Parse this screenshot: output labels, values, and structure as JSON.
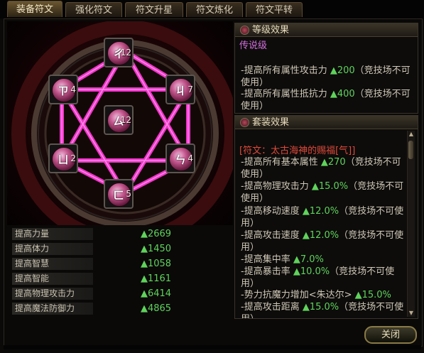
{
  "tabs": [
    {
      "label": "装备符文",
      "active": true
    },
    {
      "label": "强化符文",
      "active": false
    },
    {
      "label": "符文升星",
      "active": false
    },
    {
      "label": "符文炼化",
      "active": false
    },
    {
      "label": "符文平转",
      "active": false
    }
  ],
  "runes": [
    {
      "position": "top",
      "glyph": "ㄔ",
      "count": "12"
    },
    {
      "position": "upper-left",
      "glyph": "ㄗ",
      "count": "4"
    },
    {
      "position": "upper-right",
      "glyph": "ㄐ",
      "count": "7"
    },
    {
      "position": "center",
      "glyph": "ㄙ",
      "count": "12"
    },
    {
      "position": "lower-left",
      "glyph": "ㄩ",
      "count": "2"
    },
    {
      "position": "lower-right",
      "glyph": "ㄣ",
      "count": "4"
    },
    {
      "position": "bottom",
      "glyph": "ㄈ",
      "count": "5"
    }
  ],
  "stats": [
    {
      "label": "提高力量",
      "value": "▲2669"
    },
    {
      "label": "提高体力",
      "value": "▲1450"
    },
    {
      "label": "提高智慧",
      "value": "▲1058"
    },
    {
      "label": "提高智能",
      "value": "▲1161"
    },
    {
      "label": "提高物理攻击力",
      "value": "▲6414"
    },
    {
      "label": "提高魔法防御力",
      "value": "▲4865"
    }
  ],
  "level_effect": {
    "title": "等级效果",
    "tier": "传说级",
    "lines": [
      {
        "text": "-提高所有属性攻击力 ",
        "value": "▲200",
        "suffix": "（竞技场不可使用）"
      },
      {
        "text": "-提高所有属性抵抗力 ",
        "value": "▲400",
        "suffix": "（竞技场不可使用）"
      }
    ]
  },
  "set_effect": {
    "title": "套装效果",
    "set_name": "[符文：太古海神的赐福[气]]",
    "lines": [
      {
        "text": "-提高所有基本属性 ",
        "value": "▲270",
        "suffix": "（竞技场不可使用）"
      },
      {
        "text": "-提高物理攻击力 ",
        "value": "▲15.0%",
        "suffix": "（竞技场不可使用）"
      },
      {
        "text": "-提高移动速度 ",
        "value": "▲12.0%",
        "suffix": "（竞技场不可使用）"
      },
      {
        "text": "-提高攻击速度 ",
        "value": "▲12.0%",
        "suffix": "（竞技场不可使用）"
      },
      {
        "text": "-提高集中率 ",
        "value": "▲7.0%",
        "suffix": ""
      },
      {
        "text": "-提高暴击率 ",
        "value": "▲10.0%",
        "suffix": "（竞技场不可使用）"
      },
      {
        "text": "-势力抗魔力增加<朱达尔> ",
        "value": "▲15.0%",
        "suffix": ""
      },
      {
        "text": "-提高攻击距离 ",
        "value": "▲15.0%",
        "suffix": "（竞技场不可使用）"
      }
    ]
  },
  "close_button": "关闭",
  "colors": {
    "accent_pink": "#e040c0",
    "stat_green": "#5fd35b",
    "set_name_red": "#e04a3a",
    "tier_purple": "#d46edc"
  }
}
